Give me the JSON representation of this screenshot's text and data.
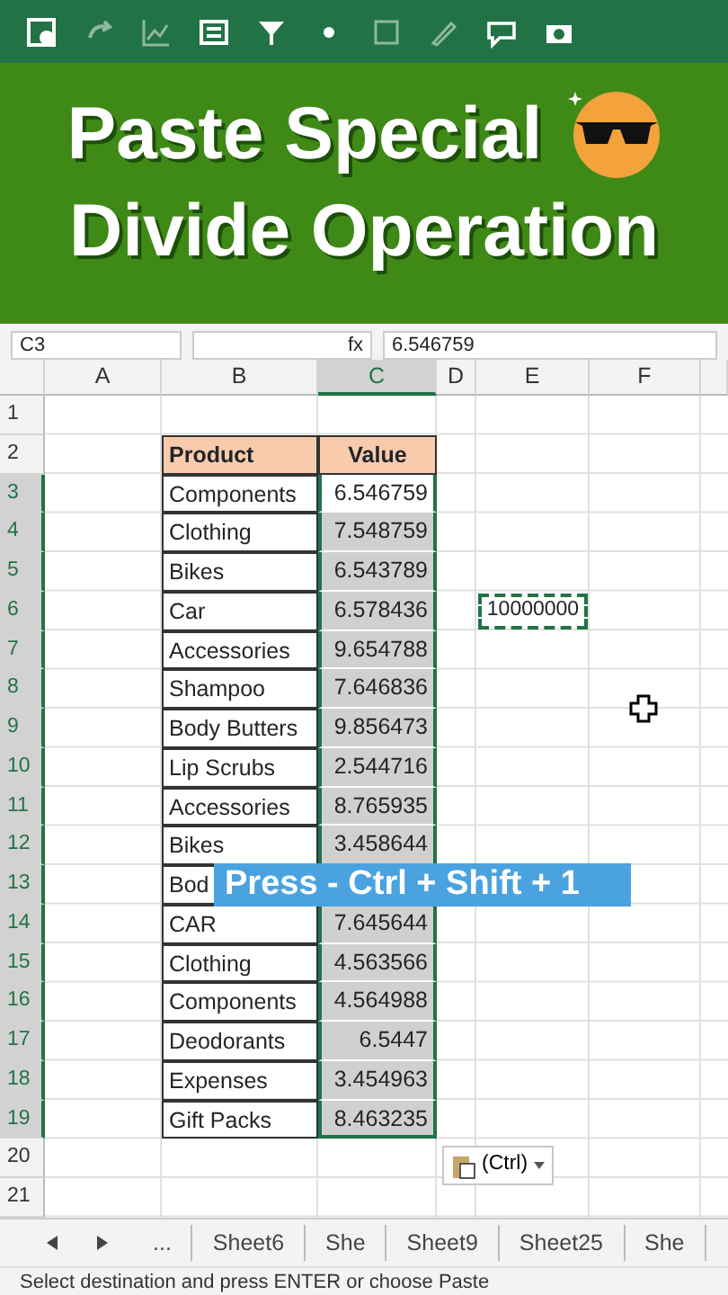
{
  "banner": {
    "line_1": "Paste Special",
    "line_2": "Divide Operation"
  },
  "formula_bar": {
    "name_box": "C3",
    "fx": "fx",
    "value": "6.546759"
  },
  "columns": [
    {
      "label": "A",
      "selected": false
    },
    {
      "label": "B",
      "selected": false
    },
    {
      "label": "C",
      "selected": true
    },
    {
      "label": "D",
      "selected": false
    },
    {
      "label": "E",
      "selected": false
    },
    {
      "label": "F",
      "selected": false
    }
  ],
  "row_numbers": [
    {
      "label": "1",
      "selected": false
    },
    {
      "label": "2",
      "selected": false
    },
    {
      "label": "3",
      "selected": true
    },
    {
      "label": "4",
      "selected": true
    },
    {
      "label": "5",
      "selected": true
    },
    {
      "label": "6",
      "selected": true
    },
    {
      "label": "7",
      "selected": true
    },
    {
      "label": "8",
      "selected": true
    },
    {
      "label": "9",
      "selected": true
    },
    {
      "label": "10",
      "selected": true
    },
    {
      "label": "11",
      "selected": true
    },
    {
      "label": "12",
      "selected": true
    },
    {
      "label": "13",
      "selected": true
    },
    {
      "label": "14",
      "selected": true
    },
    {
      "label": "15",
      "selected": true
    },
    {
      "label": "16",
      "selected": true
    },
    {
      "label": "17",
      "selected": true
    },
    {
      "label": "18",
      "selected": true
    },
    {
      "label": "19",
      "selected": true
    },
    {
      "label": "20",
      "selected": false
    },
    {
      "label": "21",
      "selected": false
    }
  ],
  "table": {
    "header": {
      "product": "Product",
      "value": "Value"
    },
    "rows": [
      {
        "product": "Components",
        "value": "6.546759"
      },
      {
        "product": "Clothing",
        "value": "7.548759"
      },
      {
        "product": "Bikes",
        "value": "6.543789"
      },
      {
        "product": "Car",
        "value": "6.578436"
      },
      {
        "product": "Accessories",
        "value": "9.654788"
      },
      {
        "product": "Shampoo",
        "value": "7.646836"
      },
      {
        "product": "Body Butters",
        "value": "9.856473"
      },
      {
        "product": "Lip Scrubs",
        "value": "2.544716"
      },
      {
        "product": "Accessories",
        "value": "8.765935"
      },
      {
        "product": "Bikes",
        "value": "3.458644"
      },
      {
        "product": "Bod",
        "value": null
      },
      {
        "product": "CAR",
        "value": "7.645644"
      },
      {
        "product": "Clothing",
        "value": "4.563566"
      },
      {
        "product": "Components",
        "value": "4.564988"
      },
      {
        "product": "Deodorants",
        "value": "6.5447"
      },
      {
        "product": "Expenses",
        "value": "3.454963"
      },
      {
        "product": "Gift Packs",
        "value": "8.463235"
      }
    ]
  },
  "copied_cell": {
    "value": "10000000"
  },
  "shortcut_hint": "Press - Ctrl + Shift + 1",
  "paste_options": {
    "label": "(Ctrl)"
  },
  "sheet_nav": {
    "more": "..."
  },
  "sheet_tabs": [
    {
      "label": "Sheet6"
    },
    {
      "label": "She"
    },
    {
      "label": "Sheet9"
    },
    {
      "label": "Sheet25"
    },
    {
      "label": "She"
    }
  ],
  "status_bar": "Select destination and press ENTER or choose Paste"
}
